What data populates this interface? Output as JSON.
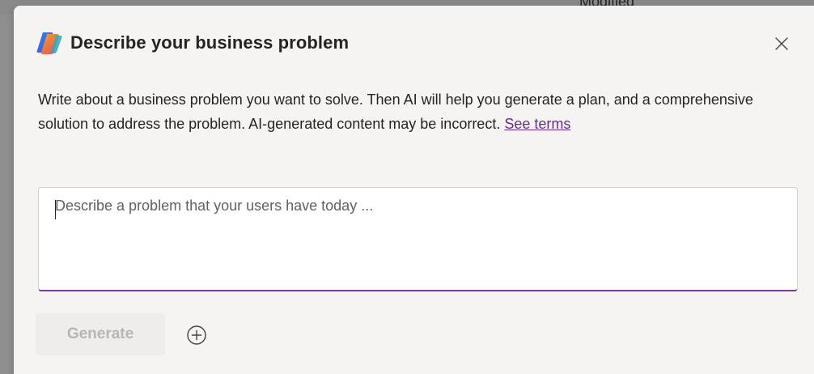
{
  "background": {
    "partial_text": "Modified"
  },
  "dialog": {
    "title": "Describe your business problem",
    "description_text": "Write about a business problem you want to solve. Then AI will help you generate a plan, and a comprehensive solution to address the problem. AI-generated content may be incorrect. ",
    "terms_link": "See terms",
    "input": {
      "placeholder": "Describe a problem that your users have today ...",
      "value": ""
    },
    "generate_label": "Generate",
    "generate_disabled": true
  },
  "icons": {
    "title": "copilot-icon",
    "close": "close-icon",
    "add": "add-circle-icon"
  },
  "colors": {
    "accent": "#7a3d91",
    "link": "#6b2c8e",
    "dialog_bg": "#f6f4f3",
    "disabled_text": "#b8b6b5",
    "disabled_bg": "#efedec"
  }
}
